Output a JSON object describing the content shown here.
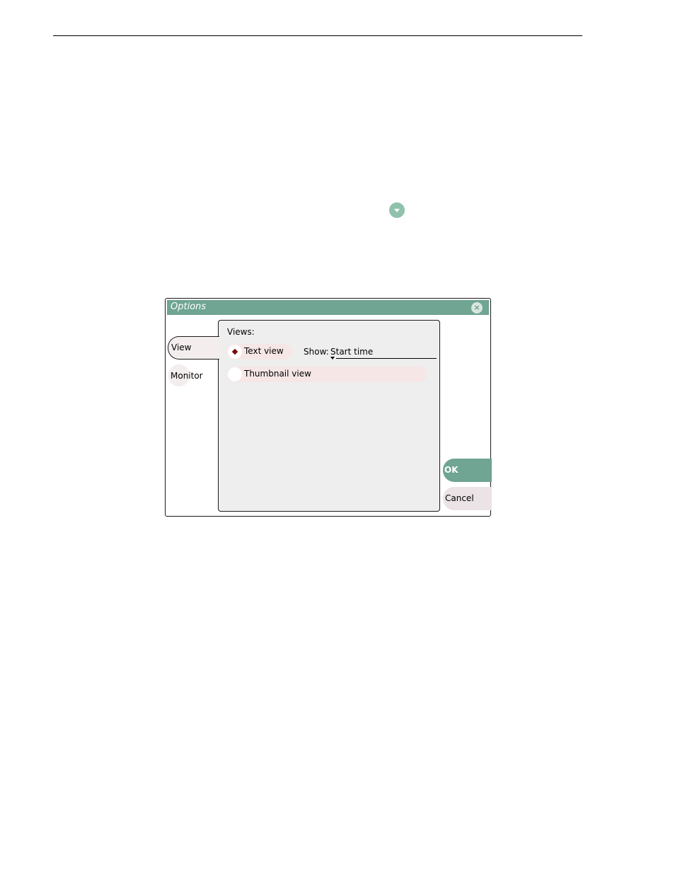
{
  "dialog": {
    "title": "Options",
    "close_icon": "×"
  },
  "tabs": [
    {
      "label": "View",
      "active": true
    },
    {
      "label": "Monitor",
      "active": false
    }
  ],
  "view_panel": {
    "views_label": "Views:",
    "options": [
      {
        "label": "Text view",
        "selected": true
      },
      {
        "label": "Thumbnail view",
        "selected": false
      }
    ],
    "show_label": "Show:",
    "show_value": "Start time"
  },
  "buttons": {
    "ok": "OK",
    "cancel": "Cancel"
  },
  "colors": {
    "accent": "#6fa592",
    "radio_selected": "#7a0a0a"
  },
  "icons": {
    "page_menu": "chevron-down-circle-icon",
    "close": "close-icon"
  }
}
